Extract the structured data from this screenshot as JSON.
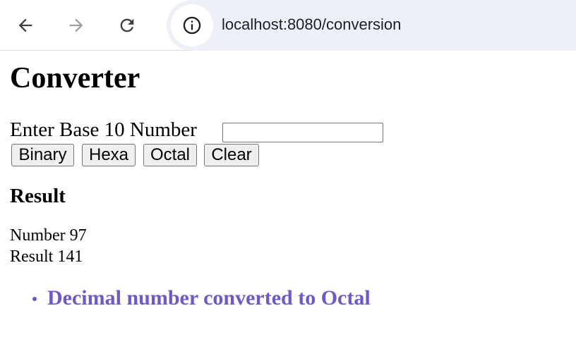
{
  "browser": {
    "url": "localhost:8080/conversion",
    "icons": {
      "back": "arrow-left-icon",
      "forward": "arrow-right-icon",
      "reload": "reload-icon",
      "site_info": "info-icon"
    }
  },
  "page": {
    "title": "Converter",
    "input_label": "Enter Base 10 Number",
    "input_value": "",
    "buttons": {
      "binary": "Binary",
      "hexa": "Hexa",
      "octal": "Octal",
      "clear": "Clear"
    },
    "result_heading": "Result",
    "number_line": "Number 97",
    "result_line": "Result 141",
    "message": "Decimal number converted to Octal"
  },
  "colors": {
    "message": "#6a5acd",
    "omnibox_bg": "#edf0f8"
  }
}
